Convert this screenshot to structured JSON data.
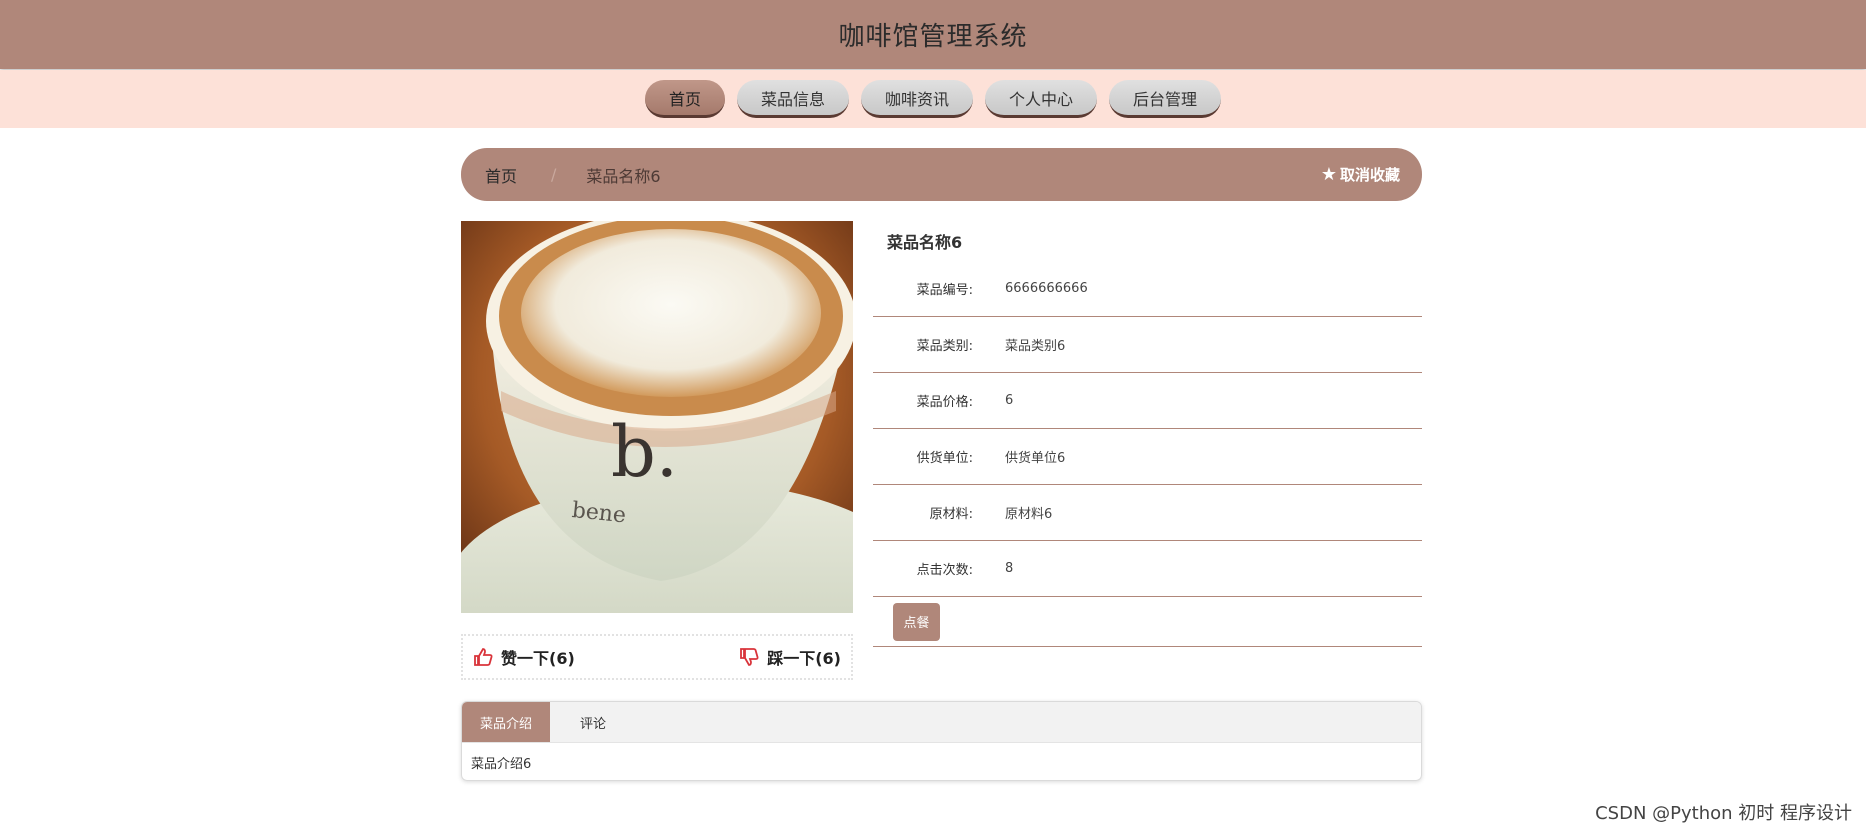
{
  "header": {
    "title": "咖啡馆管理系统"
  },
  "nav": {
    "items": [
      {
        "label": "首页",
        "active": true
      },
      {
        "label": "菜品信息",
        "active": false
      },
      {
        "label": "咖啡资讯",
        "active": false
      },
      {
        "label": "个人中心",
        "active": false
      },
      {
        "label": "后台管理",
        "active": false
      }
    ]
  },
  "breadcrumb": {
    "home": "首页",
    "current": "菜品名称6",
    "favorite_label": "取消收藏"
  },
  "product": {
    "name": "菜品名称6",
    "fields": [
      {
        "label": "菜品编号:",
        "value": "6666666666"
      },
      {
        "label": "菜品类别:",
        "value": "菜品类别6"
      },
      {
        "label": "菜品价格:",
        "value": "6"
      },
      {
        "label": "供货单位:",
        "value": "供货单位6"
      },
      {
        "label": "原材料:",
        "value": "原材料6"
      },
      {
        "label": "点击次数:",
        "value": "8"
      }
    ],
    "order_label": "点餐"
  },
  "votes": {
    "like_label": "赞一下(6)",
    "dislike_label": "踩一下(6)"
  },
  "tabs": {
    "items": [
      {
        "label": "菜品介绍",
        "active": true
      },
      {
        "label": "评论",
        "active": false
      }
    ],
    "content": "菜品介绍6"
  },
  "watermark": "CSDN @Python 初时 程序设计",
  "colors": {
    "brand": "#b0877a",
    "nav_background": "#fde1d8",
    "vote_icon": "#d9343b"
  }
}
